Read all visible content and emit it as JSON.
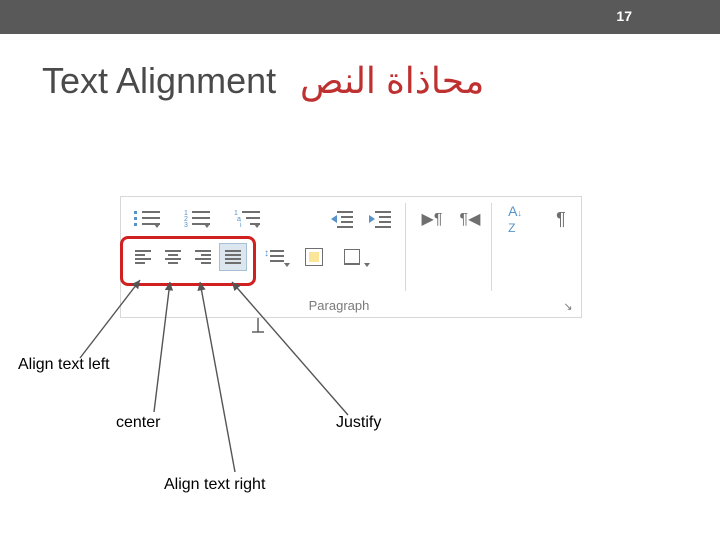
{
  "page_number": "17",
  "title_en": "Text Alignment",
  "title_ar": "محاذاة النص",
  "ribbon": {
    "group_label": "Paragraph"
  },
  "callouts": {
    "align_left": "Align text left",
    "center": "center",
    "align_right": "Align text right",
    "justify": "Justify"
  }
}
